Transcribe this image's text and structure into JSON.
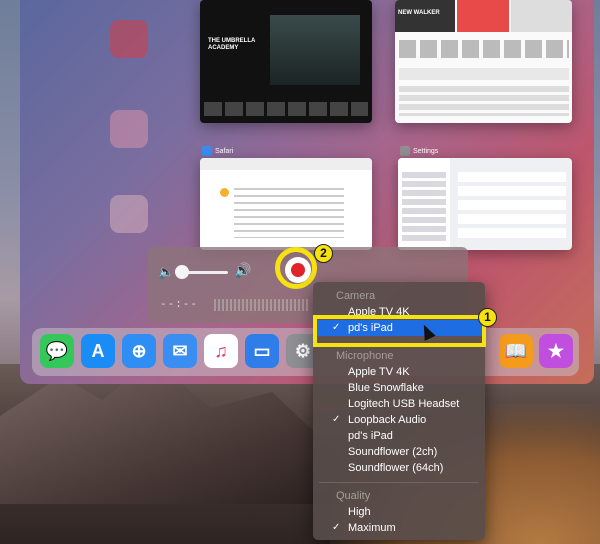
{
  "recording_panel": {
    "time_readout": "--:--",
    "volume_level": 0.05
  },
  "menu": {
    "camera_header": "Camera",
    "camera_items": [
      {
        "label": "Apple TV 4K",
        "checked": false
      },
      {
        "label": "pd's iPad",
        "checked": true
      }
    ],
    "microphone_header": "Microphone",
    "microphone_items": [
      {
        "label": "Apple TV 4K",
        "checked": false
      },
      {
        "label": "Blue Snowflake",
        "checked": false
      },
      {
        "label": "Logitech USB Headset",
        "checked": false
      },
      {
        "label": "Loopback Audio",
        "checked": true
      },
      {
        "label": "pd's iPad",
        "checked": false
      },
      {
        "label": "Soundflower (2ch)",
        "checked": false
      },
      {
        "label": "Soundflower (64ch)",
        "checked": false
      }
    ],
    "quality_header": "Quality",
    "quality_items": [
      {
        "label": "High",
        "checked": false
      },
      {
        "label": "Maximum",
        "checked": true
      }
    ],
    "check_glyph": "✓"
  },
  "ipad": {
    "cards": [
      {
        "label": "Safari"
      },
      {
        "label": "Settings"
      }
    ],
    "netflix_poster_text": "THE UMBRELLA ACADEMY",
    "music_banner_text": "NEW WALKER"
  },
  "annotations": {
    "badge_1": "1",
    "badge_2": "2",
    "highlight_color": "#f6e211"
  },
  "dock": {
    "icons": [
      "messages-icon",
      "app-store-icon",
      "safari-icon",
      "mail-icon",
      "music-icon",
      "files-icon",
      "settings-icon",
      "books-icon",
      "itunes-store-icon"
    ]
  }
}
